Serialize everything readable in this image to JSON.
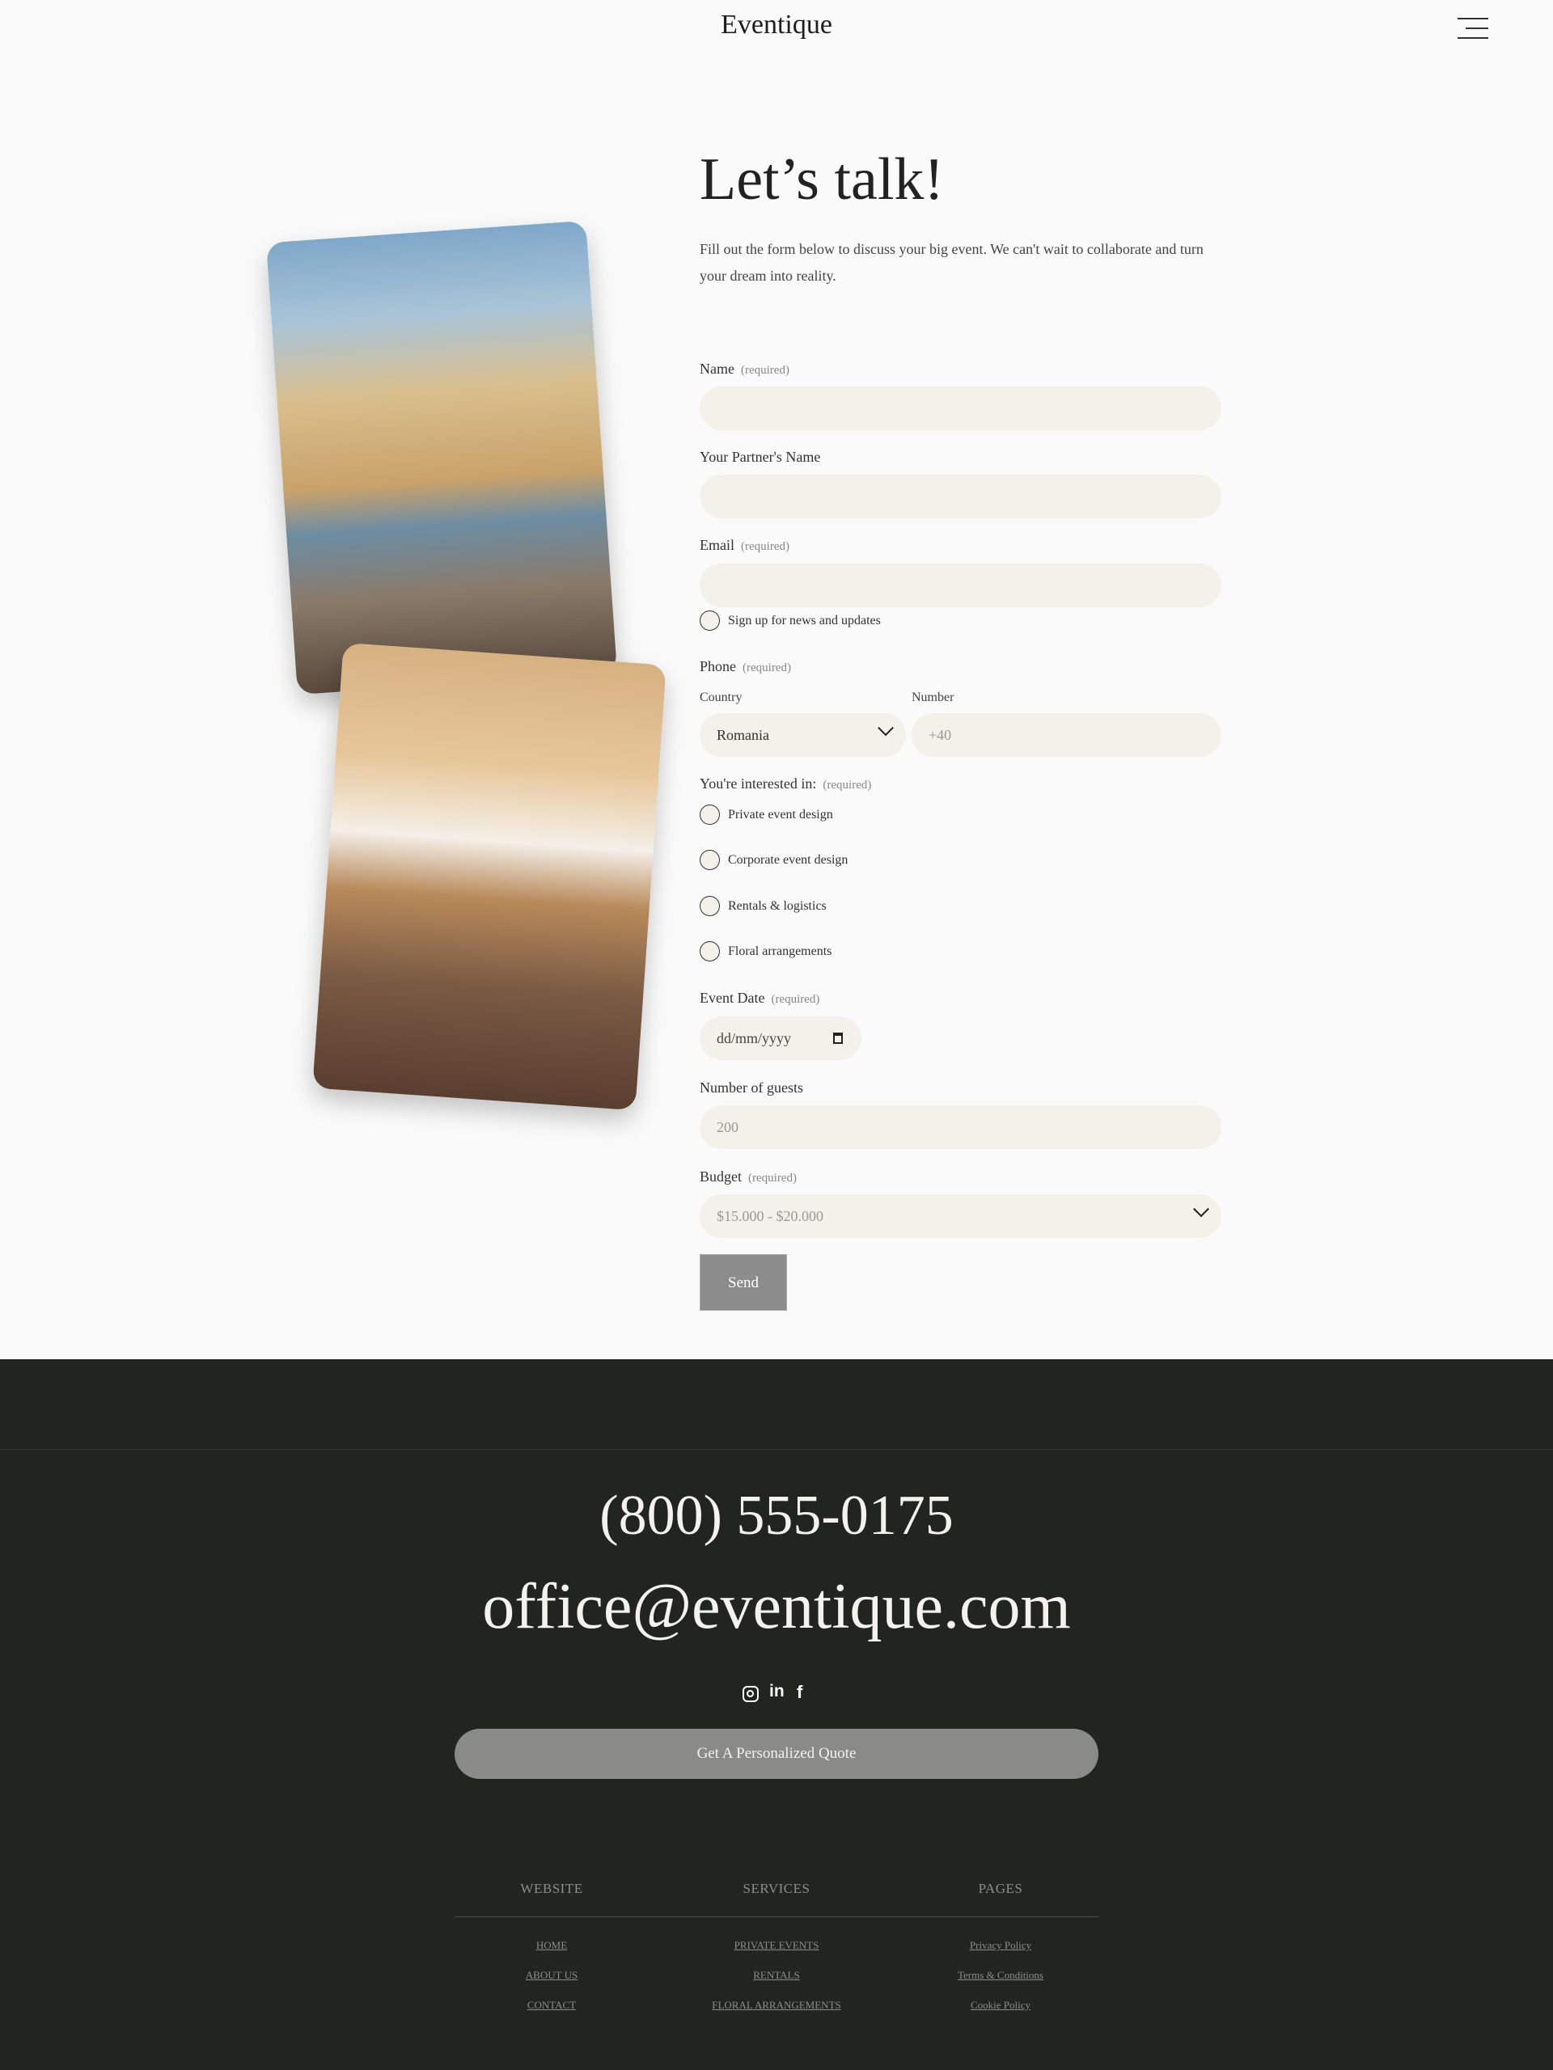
{
  "header": {
    "logo": "Eventique",
    "menu_icon": "hamburger-icon"
  },
  "hero": {
    "title": "Let’s talk!",
    "intro": "Fill out the form below to discuss your big event. We can't wait to collaborate and turn your dream into reality."
  },
  "form": {
    "required": "(required)",
    "name_label": "Name",
    "partner_label": "Your Partner's Name",
    "email_label": "Email",
    "newsletter_label": "Sign up for news and updates",
    "phone_label": "Phone",
    "country_label": "Country",
    "country_value": "Romania",
    "number_label": "Number",
    "number_placeholder": "+40",
    "interest_label": "You're interested in:",
    "interests": [
      "Private event design",
      "Corporate event design",
      "Rentals & logistics",
      "Floral arrangements"
    ],
    "date_label": "Event Date",
    "date_placeholder": "dd/mm/yyyy",
    "guests_label": "Number of guests",
    "guests_placeholder": "200",
    "budget_label": "Budget",
    "budget_value": "$15.000 - $20.000",
    "send_label": "Send"
  },
  "footer": {
    "phone": "(800) 555-0175",
    "email": "office@eventique.com",
    "social": [
      "instagram-icon",
      "linkedin-icon",
      "facebook-icon"
    ],
    "quote_button": "Get A Personalized Quote",
    "columns": [
      {
        "title": "WEBSITE",
        "links": [
          "HOME",
          "ABOUT US",
          "CONTACT"
        ]
      },
      {
        "title": "SERVICES",
        "links": [
          "PRIVATE EVENTS",
          "RENTALS",
          "FLORAL ARRANGEMENTS"
        ]
      },
      {
        "title": "PAGES",
        "links": [
          "Privacy Policy",
          "Terms & Conditions",
          "Cookie Policy"
        ]
      }
    ]
  },
  "colors": {
    "input_bg": "#f3f1e9",
    "footer_bg": "#22241f",
    "button_gray": "#8c8c8c"
  }
}
